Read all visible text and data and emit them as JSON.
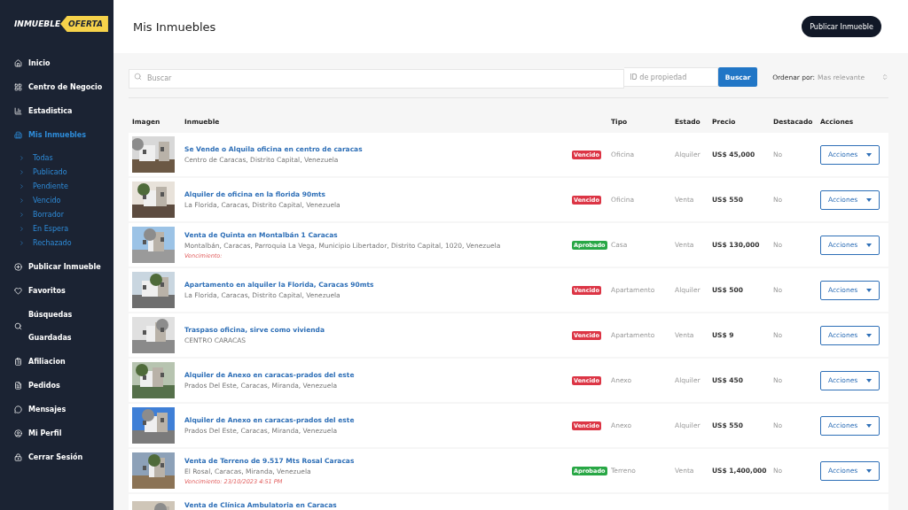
{
  "logo": {
    "part_1": "INMUEBLE",
    "part_2": "OFERTA"
  },
  "nav": [
    {
      "label": "Inicio",
      "selected": false
    },
    {
      "label": "Centro de Negocio",
      "selected": false
    },
    {
      "label": "Estadistica",
      "selected": false
    },
    {
      "label": "Mis Inmuebles",
      "selected": true,
      "children": [
        "Todas",
        "Publicado",
        "Pendiente",
        "Vencido",
        "Borrador",
        "En Espera",
        "Rechazado"
      ]
    },
    {
      "label": "Publicar Inmueble",
      "selected": false
    },
    {
      "label": "Favoritos",
      "selected": false
    },
    {
      "label": "Búsquedas\nGuardadas",
      "selected": false
    },
    {
      "label": "Afiliacion",
      "selected": false
    },
    {
      "label": "Pedidos",
      "selected": false
    },
    {
      "label": "Mensajes",
      "selected": false
    },
    {
      "label": "Mi Perfil",
      "selected": false
    },
    {
      "label": "Cerrar Sesión",
      "selected": false
    }
  ],
  "header": {
    "title": "Mis Inmuebles",
    "button": "Publicar Inmueble"
  },
  "search": {
    "placeholder": "Buscar",
    "id_placeholder": "ID de propiedad",
    "button": "Buscar",
    "sort_label": "Ordenar por:",
    "sort_value": "Mas relevante"
  },
  "table": {
    "columns": [
      "Imagen",
      "Inmueble",
      "Tipo",
      "Estado",
      "Precio",
      "Destacado",
      "Acciones"
    ],
    "rows": [
      {
        "title": "Se Vende o Alquila oficina en centro de caracas",
        "location": "Centro de Caracas, Distrito Capital, Venezuela",
        "status": {
          "label": "Vencido",
          "color": "#dc3545"
        },
        "type": "Oficina",
        "state": "Alquiler",
        "price": "US$ 45,000",
        "featured": "No",
        "action": "Acciones"
      },
      {
        "title": "Alquiler de oficina en la florida 90mts",
        "location": "La Florida, Caracas, Distrito Capital, Venezuela",
        "status": {
          "label": "Vencido",
          "color": "#dc3545"
        },
        "type": "Oficina",
        "state": "Venta",
        "price": "US$ 550",
        "featured": "No",
        "action": "Acciones"
      },
      {
        "title": "Venta de Quinta en Montalbán 1 Caracas",
        "location": "Montalbán, Caracas, Parroquia La Vega, Municipio Libertador, Distrito Capital, 1020, Venezuela",
        "expiry": "Vencimiento:",
        "status": {
          "label": "Aprobado",
          "color": "#28a745"
        },
        "type": "Casa",
        "state": "Venta",
        "price": "US$ 130,000",
        "featured": "No",
        "action": "Acciones"
      },
      {
        "title": "Apartamento en alquiler la Florida, Caracas 90mts",
        "location": "La Florida, Caracas, Distrito Capital, Venezuela",
        "status": {
          "label": "Vencido",
          "color": "#dc3545"
        },
        "type": "Apartamento",
        "state": "Alquiler",
        "price": "US$ 500",
        "featured": "No",
        "action": "Acciones"
      },
      {
        "title": "Traspaso oficina, sirve como vivienda",
        "location": "CENTRO CARACAS",
        "status": {
          "label": "Vencido",
          "color": "#dc3545"
        },
        "type": "Apartamento",
        "state": "Venta",
        "price": "US$ 9",
        "featured": "No",
        "action": "Acciones"
      },
      {
        "title": "Alquiler de Anexo en caracas-prados del este",
        "location": "Prados Del Este, Caracas, Miranda, Venezuela",
        "status": {
          "label": "Vencido",
          "color": "#dc3545"
        },
        "type": "Anexo",
        "state": "Alquiler",
        "price": "US$ 450",
        "featured": "No",
        "action": "Acciones"
      },
      {
        "title": "Alquiler de Anexo en caracas-prados del este",
        "location": "Prados Del Este, Caracas, Miranda, Venezuela",
        "status": {
          "label": "Vencido",
          "color": "#dc3545"
        },
        "type": "Anexo",
        "state": "Alquiler",
        "price": "US$ 550",
        "featured": "No",
        "action": "Acciones"
      },
      {
        "title": "Venta de Terreno de 9.517 Mts Rosal Caracas",
        "location": "El Rosal, Caracas, Miranda, Venezuela",
        "expiry": "Vencimiento: 23/10/2023 4:51 PM",
        "status": {
          "label": "Aprobado",
          "color": "#28a745"
        },
        "type": "Terreno",
        "state": "Venta",
        "price": "US$ 1,400,000",
        "featured": "No",
        "action": "Acciones"
      },
      {
        "title": "Venta de Clínica Ambulatoria en Caracas"
      }
    ]
  }
}
